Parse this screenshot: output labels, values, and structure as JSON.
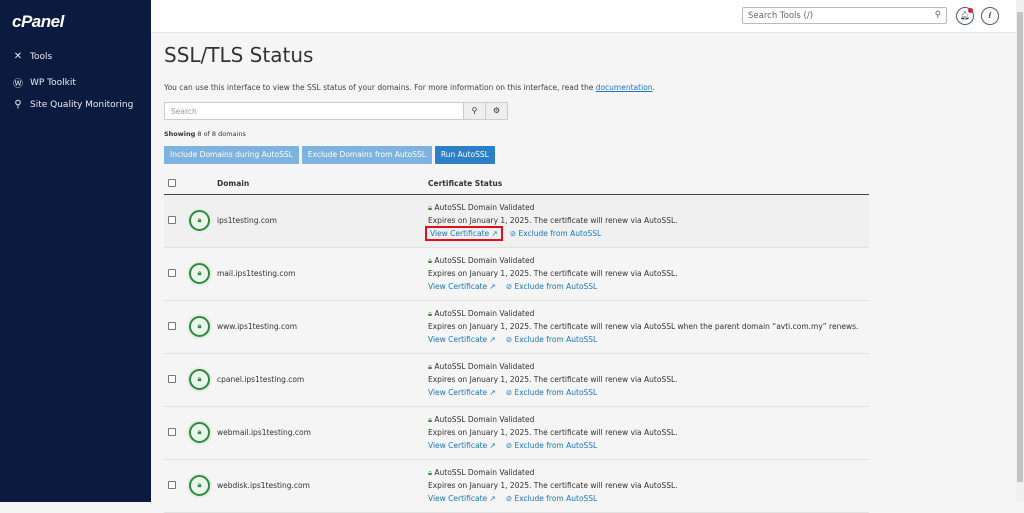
{
  "sidebar": {
    "logo": "cPanel",
    "items": [
      {
        "label": "Tools",
        "icon": "tools-icon"
      },
      {
        "label": "WP Toolkit",
        "icon": "wordpress-icon"
      },
      {
        "label": "Site Quality Monitoring",
        "icon": "site-quality-icon"
      }
    ]
  },
  "header": {
    "search_placeholder": "Search Tools (/)"
  },
  "page": {
    "title": "SSL/TLS Status",
    "intro": "You can use this interface to view the SSL status of your domains. For more information on this interface, read the ",
    "intro_link": "documentation",
    "intro_end": ".",
    "search_placeholder": "Search",
    "showing_label": "Showing",
    "showing_count": "8 of 8 domains"
  },
  "buttons": {
    "include": "Include Domains during AutoSSL",
    "exclude": "Exclude Domains from AutoSSL",
    "run": "Run AutoSSL"
  },
  "table": {
    "col_domain": "Domain",
    "col_status": "Certificate Status",
    "rows": [
      {
        "domain": "ips1testing.com",
        "status": "AutoSSL Domain Validated",
        "expires": "Expires on January 1, 2025. The certificate will renew via AutoSSL.",
        "view": "View Certificate",
        "exclude": "Exclude from AutoSSL"
      },
      {
        "domain": "mail.ips1testing.com",
        "status": "AutoSSL Domain Validated",
        "expires": "Expires on January 1, 2025. The certificate will renew via AutoSSL.",
        "view": "View Certificate",
        "exclude": "Exclude from AutoSSL"
      },
      {
        "domain": "www.ips1testing.com",
        "status": "AutoSSL Domain Validated",
        "expires": "Expires on January 1, 2025. The certificate will renew via AutoSSL when the parent domain “avti.com.my” renews.",
        "view": "View Certificate",
        "exclude": "Exclude from AutoSSL"
      },
      {
        "domain": "cpanel.ips1testing.com",
        "status": "AutoSSL Domain Validated",
        "expires": "Expires on January 1, 2025. The certificate will renew via AutoSSL.",
        "view": "View Certificate",
        "exclude": "Exclude from AutoSSL"
      },
      {
        "domain": "webmail.ips1testing.com",
        "status": "AutoSSL Domain Validated",
        "expires": "Expires on January 1, 2025. The certificate will renew via AutoSSL.",
        "view": "View Certificate",
        "exclude": "Exclude from AutoSSL"
      },
      {
        "domain": "webdisk.ips1testing.com",
        "status": "AutoSSL Domain Validated",
        "expires": "Expires on January 1, 2025. The certificate will renew via AutoSSL.",
        "view": "View Certificate",
        "exclude": "Exclude from AutoSSL"
      }
    ]
  }
}
